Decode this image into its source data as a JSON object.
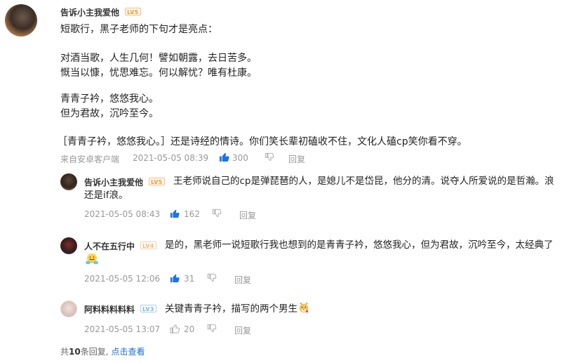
{
  "comment": {
    "username": "告诉小主我爱他",
    "level": "LV5",
    "lines": [
      "短歌行，黑子老师的下句才是亮点：",
      "对酒当歌，人生几何！譬如朝露，去日苦多。",
      "慨当以慷，忧思难忘。何以解忧？唯有杜康。",
      "青青子衿，悠悠我心。",
      "但为君故，沉吟至今。",
      "［青青子衿，悠悠我心。］还是诗经的情诗。你们笑长辈初磕收不住，文化人磕cp笑你看不穿。"
    ],
    "source": "来自安卓客户端",
    "time": "2021-05-05 08:39",
    "likes": "300",
    "reply_label": "回复"
  },
  "replies": [
    {
      "username": "告诉小主我爱他",
      "level": "LV5",
      "text_line1": "王老师说自己的cp是弹琵琶的人，是媳儿不是岱昆，他分的清。说夺人所爱说的是哲瀚。浪",
      "text_line2": "还是if浪。",
      "time": "2021-05-05 08:43",
      "likes": "162",
      "reply_label": "回复"
    },
    {
      "username": "人不在五行中",
      "level": "LV4",
      "text_line1": "是的，黑老师一说短歌行我也想到的是青青子衿，悠悠我心，但为君故，沉吟至今，太经典了",
      "time": "2021-05-05 12:06",
      "likes": "31",
      "reply_label": "回复"
    },
    {
      "username": "阿料料料料料",
      "level": "LV3",
      "text_line1": "关键青青子衿，描写的两个男生",
      "time": "2021-05-05 13:07",
      "likes": "20",
      "reply_label": "回复"
    }
  ],
  "footer": {
    "prefix": "共",
    "count": "10",
    "suffix": "条回复,",
    "link": "点击查看"
  },
  "colors": {
    "like_icon": "#1a73e8",
    "link": "#1a6fd1",
    "meta": "#999999",
    "level_orange": "#ff8f1f"
  }
}
